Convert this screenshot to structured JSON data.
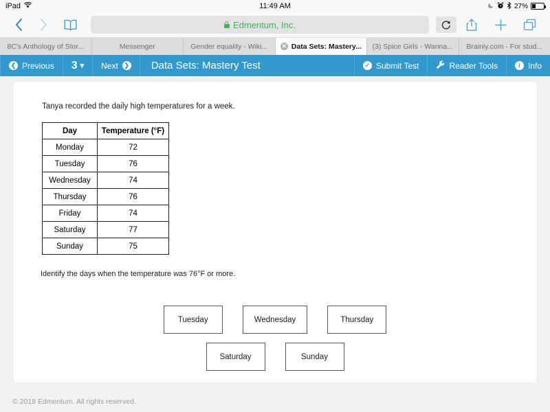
{
  "status_bar": {
    "device": "iPad",
    "wifi_icon": "wifi-icon",
    "time": "11:49 AM",
    "do_not_disturb_icon": "moon-icon",
    "alarm_icon": "alarm-clock-icon",
    "bluetooth_icon": "bluetooth-icon",
    "battery_percent": "27%"
  },
  "browser": {
    "back_icon": "chevron-left-icon",
    "forward_icon": "chevron-right-icon",
    "bookmarks_icon": "book-icon",
    "lock_icon": "lock-icon",
    "url_text": "Edmentum, Inc.",
    "reload_icon": "reload-icon",
    "share_icon": "share-icon",
    "newtab_icon": "plus-icon",
    "tabs_icon": "tabs-icon",
    "tabs": [
      {
        "title": "8C's Anthology of Stor...",
        "active": false
      },
      {
        "title": "Messenger",
        "active": false
      },
      {
        "title": "Gender equality - Wiki...",
        "active": false
      },
      {
        "title": "Data Sets: Mastery...",
        "active": true,
        "close_icon": "close-icon",
        "close_glyph": "✕"
      },
      {
        "title": "(3) Spice Girls - Wanna...",
        "active": false
      },
      {
        "title": "Brainly.com - For stud...",
        "active": false
      }
    ]
  },
  "app_toolbar": {
    "accent_color": "#3399cc",
    "previous_label": "Previous",
    "previous_icon": "arrow-left-circle-icon",
    "page_number": "3",
    "page_chevron_icon": "chevron-down-icon",
    "next_label": "Next",
    "next_icon": "arrow-right-circle-icon",
    "title": "Data Sets: Mastery Test",
    "submit_label": "Submit Test",
    "submit_icon": "check-circle-icon",
    "reader_tools_label": "Reader Tools",
    "reader_tools_icon": "wrench-icon",
    "info_label": "Info",
    "info_icon": "info-circle-icon"
  },
  "question": {
    "prompt": "Tanya recorded the daily high temperatures for a week.",
    "instruction": "Identify the days when the temperature was 76°F or more.",
    "table": {
      "headers": [
        "Day",
        "Temperature (°F)"
      ],
      "rows": [
        [
          "Monday",
          "72"
        ],
        [
          "Tuesday",
          "76"
        ],
        [
          "Wednesday",
          "74"
        ],
        [
          "Thursday",
          "76"
        ],
        [
          "Friday",
          "74"
        ],
        [
          "Saturday",
          "77"
        ],
        [
          "Sunday",
          "75"
        ]
      ]
    },
    "choices_row1": [
      "Tuesday",
      "Wednesday",
      "Thursday"
    ],
    "choices_row2": [
      "Saturday",
      "Sunday"
    ]
  },
  "footer": {
    "copyright": "© 2018 Edmentum. All rights reserved."
  }
}
